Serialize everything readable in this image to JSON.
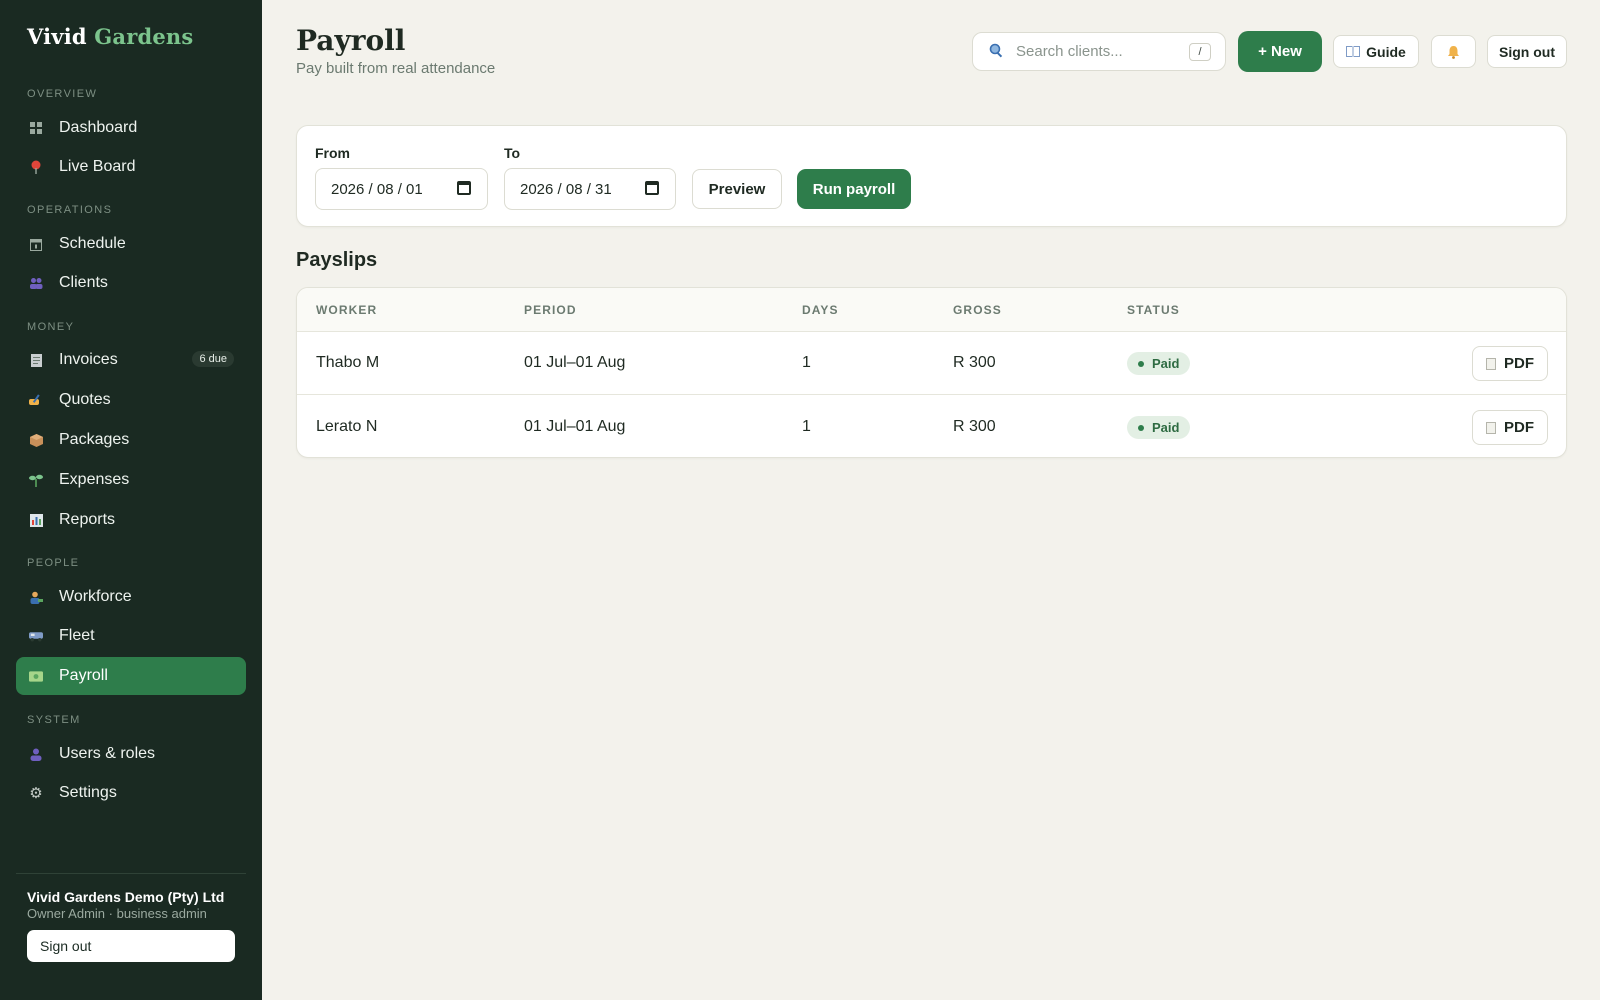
{
  "brand": {
    "part1": "Vivid",
    "part2": "Gardens"
  },
  "sidebar": {
    "sections": [
      {
        "label": "OVERVIEW"
      },
      {
        "label": "OPERATIONS"
      },
      {
        "label": "MONEY"
      },
      {
        "label": "PEOPLE"
      },
      {
        "label": "SYSTEM"
      }
    ],
    "items": [
      {
        "label": "Dashboard",
        "icon": "grid-icon"
      },
      {
        "label": "Live Board",
        "icon": "pin-icon"
      },
      {
        "label": "Schedule",
        "icon": "calendar-icon"
      },
      {
        "label": "Clients",
        "icon": "people-icon"
      },
      {
        "label": "Invoices",
        "icon": "receipt-icon",
        "badge": "6 due"
      },
      {
        "label": "Quotes",
        "icon": "pen-hand-icon"
      },
      {
        "label": "Packages",
        "icon": "box-icon"
      },
      {
        "label": "Expenses",
        "icon": "seedling-icon"
      },
      {
        "label": "Reports",
        "icon": "bar-chart-icon"
      },
      {
        "label": "Workforce",
        "icon": "worker-icon"
      },
      {
        "label": "Fleet",
        "icon": "van-icon"
      },
      {
        "label": "Payroll",
        "icon": "money-icon",
        "active": true
      },
      {
        "label": "Users & roles",
        "icon": "user-icon"
      },
      {
        "label": "Settings",
        "icon": "gear-icon"
      }
    ],
    "org": {
      "name": "Vivid Gardens Demo (Pty) Ltd",
      "role": "Owner Admin · business admin"
    },
    "signout_label": "Sign out"
  },
  "header": {
    "title": "Payroll",
    "subtitle": "Pay built from real attendance",
    "search_placeholder": "Search clients...",
    "search_shortcut": "/",
    "new_label": "+ New",
    "guide_label": "Guide",
    "signout_label": "Sign out"
  },
  "filters": {
    "from_label": "From",
    "from_value": "2026 / 08 / 01",
    "to_label": "To",
    "to_value": "2026 / 08 / 31",
    "preview_label": "Preview",
    "run_label": "Run payroll"
  },
  "payslips": {
    "title": "Payslips",
    "columns": [
      "WORKER",
      "PERIOD",
      "DAYS",
      "GROSS",
      "STATUS"
    ],
    "rows": [
      {
        "worker": "Thabo M",
        "period": "01 Jul–01 Aug",
        "days": "1",
        "gross": "R 300",
        "status": "Paid",
        "action": "PDF"
      },
      {
        "worker": "Lerato N",
        "period": "01 Jul–01 Aug",
        "days": "1",
        "gross": "R 300",
        "status": "Paid",
        "action": "PDF"
      }
    ]
  },
  "colors": {
    "sidebar_bg": "#1a2a22",
    "accent": "#2e7d4b",
    "page_bg": "#f3f2ec",
    "brand_accent": "#7cc48d"
  }
}
